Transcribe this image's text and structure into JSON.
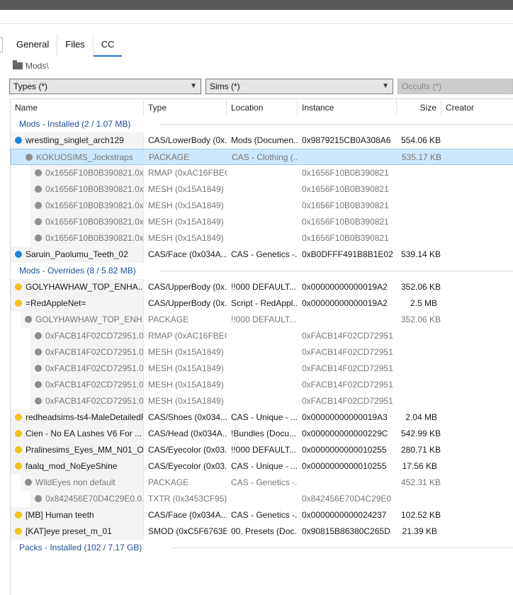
{
  "tabs": [
    {
      "label": "General",
      "active": false
    },
    {
      "label": "Files",
      "active": false
    },
    {
      "label": "CC",
      "active": true
    }
  ],
  "breadcrumb": {
    "path": "Mods\\",
    "icon": "folder-icon"
  },
  "filters": {
    "types": "Types (*)",
    "sims": "Sims (*)",
    "occults": "Occults (*)"
  },
  "columns": {
    "name": "Name",
    "type": "Type",
    "location": "Location",
    "instance": "Instance",
    "size": "Size",
    "creator": "Creator"
  },
  "colors": {
    "accent": "#2a6ed1",
    "group": "#1f4e9c",
    "installed_dot": "#1a88e0",
    "override_dot": "#f5c211",
    "child_dot": "#8e8e8e",
    "selection": "#cce8ff"
  },
  "rows": [
    {
      "kind": "group",
      "title": "Mods - Installed  (2 / 1.07 MB)"
    },
    {
      "kind": "item",
      "level": 0,
      "dot": "blue",
      "name": "wrestling_singlet_arch129",
      "type": "CAS/LowerBody (0x...",
      "location": "Mods (Documen...",
      "instance": "0x9879215CB0A308A6",
      "size": "554.06 KB",
      "gray": false
    },
    {
      "kind": "item",
      "level": 1,
      "dot": "gray",
      "name": "KOKUOSIMS_Jockstraps",
      "type": "PACKAGE",
      "location": "CAS - Clothing (...",
      "instance": "",
      "size": "535.17 KB",
      "gray": true,
      "selected": true
    },
    {
      "kind": "item",
      "level": 2,
      "dot": "gray",
      "name": "0x1656F10B0B390821.0x...",
      "type": "RMAP (0xAC16FBEC)",
      "location": "",
      "instance": "0x1656F10B0B390821",
      "size": "",
      "gray": true
    },
    {
      "kind": "item",
      "level": 2,
      "dot": "gray",
      "name": "0x1656F10B0B390821.0x...",
      "type": "MESH (0x15A1849)",
      "location": "",
      "instance": "0x1656F10B0B390821",
      "size": "",
      "gray": true
    },
    {
      "kind": "item",
      "level": 2,
      "dot": "gray",
      "name": "0x1656F10B0B390821.0x...",
      "type": "MESH (0x15A1849)",
      "location": "",
      "instance": "0x1656F10B0B390821",
      "size": "",
      "gray": true
    },
    {
      "kind": "item",
      "level": 2,
      "dot": "gray",
      "name": "0x1656F10B0B390821.0x...",
      "type": "MESH (0x15A1849)",
      "location": "",
      "instance": "0x1656F10B0B390821",
      "size": "",
      "gray": true
    },
    {
      "kind": "item",
      "level": 2,
      "dot": "gray",
      "name": "0x1656F10B0B390821.0x...",
      "type": "MESH (0x15A1849)",
      "location": "",
      "instance": "0x1656F10B0B390821",
      "size": "",
      "gray": true
    },
    {
      "kind": "item",
      "level": 0,
      "dot": "blue",
      "name": "Saruin_Paolumu_Teeth_02",
      "type": "CAS/Face (0x034A...",
      "location": "CAS - Genetics -...",
      "instance": "0xB0DFFF491B8B1E02",
      "size": "539.14 KB",
      "gray": false
    },
    {
      "kind": "group",
      "title": "Mods - Overrides  (8 / 5.82 MB)"
    },
    {
      "kind": "item",
      "level": 0,
      "dot": "yellow",
      "name": "GOLYHAWHAW_TOP_ENHA...",
      "type": "CAS/UpperBody (0x...",
      "location": "!!000 DEFAULT...",
      "instance": "0x00000000000019A2",
      "size": "352.06 KB",
      "gray": false
    },
    {
      "kind": "item",
      "level": 0,
      "dot": "yellow",
      "name": "=RedAppleNet=",
      "type": "CAS/UpperBody (0x...",
      "location": "Script - RedAppl...",
      "instance": "0x00000000000019A2",
      "size": "2.5 MB",
      "gray": false
    },
    {
      "kind": "item",
      "level": 1,
      "dot": "gray",
      "name": "GOLYHAWHAW_TOP_ENH...",
      "type": "PACKAGE",
      "location": "!!000 DEFAULT...",
      "instance": "",
      "size": "352.06 KB",
      "gray": true
    },
    {
      "kind": "item",
      "level": 2,
      "dot": "gray",
      "name": "0xFACB14F02CD72951.0...",
      "type": "RMAP (0xAC16FBEC)",
      "location": "",
      "instance": "0xFACB14F02CD72951",
      "size": "",
      "gray": true
    },
    {
      "kind": "item",
      "level": 2,
      "dot": "gray",
      "name": "0xFACB14F02CD72951.0...",
      "type": "MESH (0x15A1849)",
      "location": "",
      "instance": "0xFACB14F02CD72951",
      "size": "",
      "gray": true
    },
    {
      "kind": "item",
      "level": 2,
      "dot": "gray",
      "name": "0xFACB14F02CD72951.0...",
      "type": "MESH (0x15A1849)",
      "location": "",
      "instance": "0xFACB14F02CD72951",
      "size": "",
      "gray": true
    },
    {
      "kind": "item",
      "level": 2,
      "dot": "gray",
      "name": "0xFACB14F02CD72951.0...",
      "type": "MESH (0x15A1849)",
      "location": "",
      "instance": "0xFACB14F02CD72951",
      "size": "",
      "gray": true
    },
    {
      "kind": "item",
      "level": 2,
      "dot": "gray",
      "name": "0xFACB14F02CD72951.0...",
      "type": "MESH (0x15A1849)",
      "location": "",
      "instance": "0xFACB14F02CD72951",
      "size": "",
      "gray": true
    },
    {
      "kind": "item",
      "level": 0,
      "dot": "yellow",
      "name": "redheadsims-ts4-MaleDetailedF...",
      "type": "CAS/Shoes (0x034...",
      "location": "CAS - Unique - ...",
      "instance": "0x00000000000019A3",
      "size": "2.04 MB",
      "gray": false
    },
    {
      "kind": "item",
      "level": 0,
      "dot": "yellow",
      "name": "Cien   -   No EA Lashes V6  For ...",
      "type": "CAS/Head (0x034A...",
      "location": "!Bundles (Docu...",
      "instance": "0x000000000000229C",
      "size": "542.99 KB",
      "gray": false
    },
    {
      "kind": "item",
      "level": 0,
      "dot": "yellow",
      "name": "Pralinesims_Eyes_MM_N01_Oa...",
      "type": "CAS/Eyecolor (0x03...",
      "location": "!!000 DEFAULT...",
      "instance": "0x0000000000010255",
      "size": "280.71 KB",
      "gray": false
    },
    {
      "kind": "item",
      "level": 0,
      "dot": "yellow",
      "name": "faalq_mod_NoEyeShine",
      "type": "CAS/Eyecolor (0x03...",
      "location": "CAS - Unique - ...",
      "instance": "0x0000000000010255",
      "size": "17.56 KB",
      "gray": false
    },
    {
      "kind": "item",
      "level": 1,
      "dot": "gray",
      "name": "WildEyes non default",
      "type": "PACKAGE",
      "location": "CAS - Genetics -...",
      "instance": "",
      "size": "452.31 KB",
      "gray": true
    },
    {
      "kind": "item",
      "level": 2,
      "dot": "gray",
      "name": "0x842456E70D4C29E0.0...",
      "type": "TXTR (0x3453CF95)",
      "location": "",
      "instance": "0x842456E70D4C29E0",
      "size": "",
      "gray": true
    },
    {
      "kind": "item",
      "level": 0,
      "dot": "yellow",
      "name": "[MB] Human teeth",
      "type": "CAS/Face (0x034A...",
      "location": "CAS - Genetics -...",
      "instance": "0x0000000000024237",
      "size": "102.52 KB",
      "gray": false
    },
    {
      "kind": "item",
      "level": 0,
      "dot": "yellow",
      "name": "[KAT]eye preset_m_01",
      "type": "SMOD (0xC5F6763E)",
      "location": "00. Presets (Doc...",
      "instance": "0x90815B86380C265D",
      "size": "21.39 KB",
      "gray": false
    },
    {
      "kind": "group",
      "title": "Packs - Installed  (102 / 7.17 GB)"
    }
  ]
}
